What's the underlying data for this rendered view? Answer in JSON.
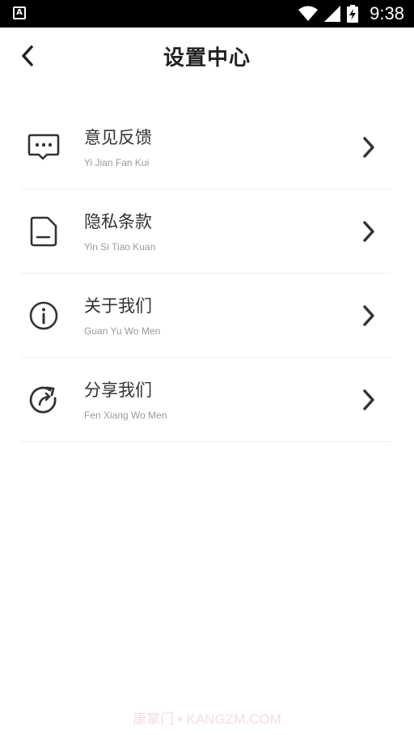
{
  "status_bar": {
    "time": "9:38",
    "icons": [
      "app-a-icon",
      "wifi-icon",
      "signal-icon",
      "battery-charging-icon"
    ]
  },
  "header": {
    "title": "设置中心",
    "back_icon": "chevron-left-icon"
  },
  "menu": {
    "items": [
      {
        "title": "意见反馈",
        "subtitle": "Yi Jian Fan Kui",
        "icon": "message-dots-icon"
      },
      {
        "title": "隐私条款",
        "subtitle": "Yin Si Tiao Kuan",
        "icon": "document-icon"
      },
      {
        "title": "关于我们",
        "subtitle": "Guan Yu Wo Men",
        "icon": "info-circle-icon"
      },
      {
        "title": "分享我们",
        "subtitle": "Fen Xiang Wo Men",
        "icon": "share-rotate-icon"
      }
    ]
  },
  "watermark": {
    "text": "康掌门 • KANGZM.COM"
  },
  "colors": {
    "title_text": "#222222",
    "subtitle_text": "#9a9a9a",
    "divider": "#eeeeee",
    "status_bar": "#000000"
  }
}
